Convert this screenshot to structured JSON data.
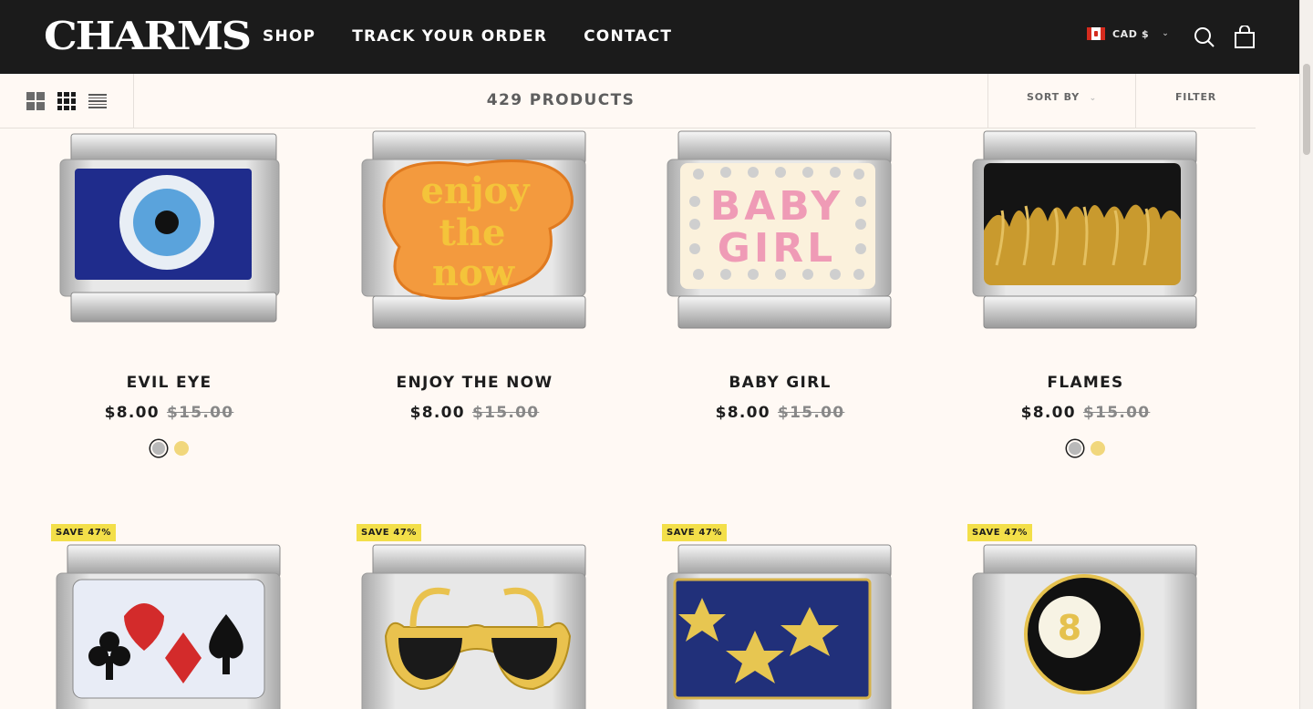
{
  "header": {
    "logo": "CHARMS",
    "nav": [
      "SHOP",
      "TRACK YOUR ORDER",
      "CONTACT"
    ],
    "currency": "CAD $"
  },
  "toolbar": {
    "count": "429 PRODUCTS",
    "sort_label": "SORT BY",
    "filter_label": "FILTER"
  },
  "products": [
    {
      "name": "EVIL EYE",
      "price": "$8.00",
      "compare": "$15.00",
      "swatches": [
        "silver",
        "gold"
      ]
    },
    {
      "name": "ENJOY THE NOW",
      "price": "$8.00",
      "compare": "$15.00",
      "swatches": []
    },
    {
      "name": "BABY GIRL",
      "price": "$8.00",
      "compare": "$15.00",
      "swatches": []
    },
    {
      "name": "FLAMES",
      "price": "$8.00",
      "compare": "$15.00",
      "swatches": [
        "silver",
        "gold"
      ]
    }
  ],
  "products_row2": [
    {
      "badge": "SAVE 47%"
    },
    {
      "badge": "SAVE 47%"
    },
    {
      "badge": "SAVE 47%"
    },
    {
      "badge": "SAVE 47%"
    }
  ],
  "charm_text": {
    "enjoy": [
      "enjoy",
      "the",
      "now"
    ],
    "baby": [
      "BABY",
      "GIRL"
    ],
    "eight": "8"
  },
  "colors": {
    "header_bg": "#1b1b1b",
    "page_bg": "#fff9f4",
    "badge": "#f3df49",
    "gold_swatch": "#f1d77c"
  }
}
